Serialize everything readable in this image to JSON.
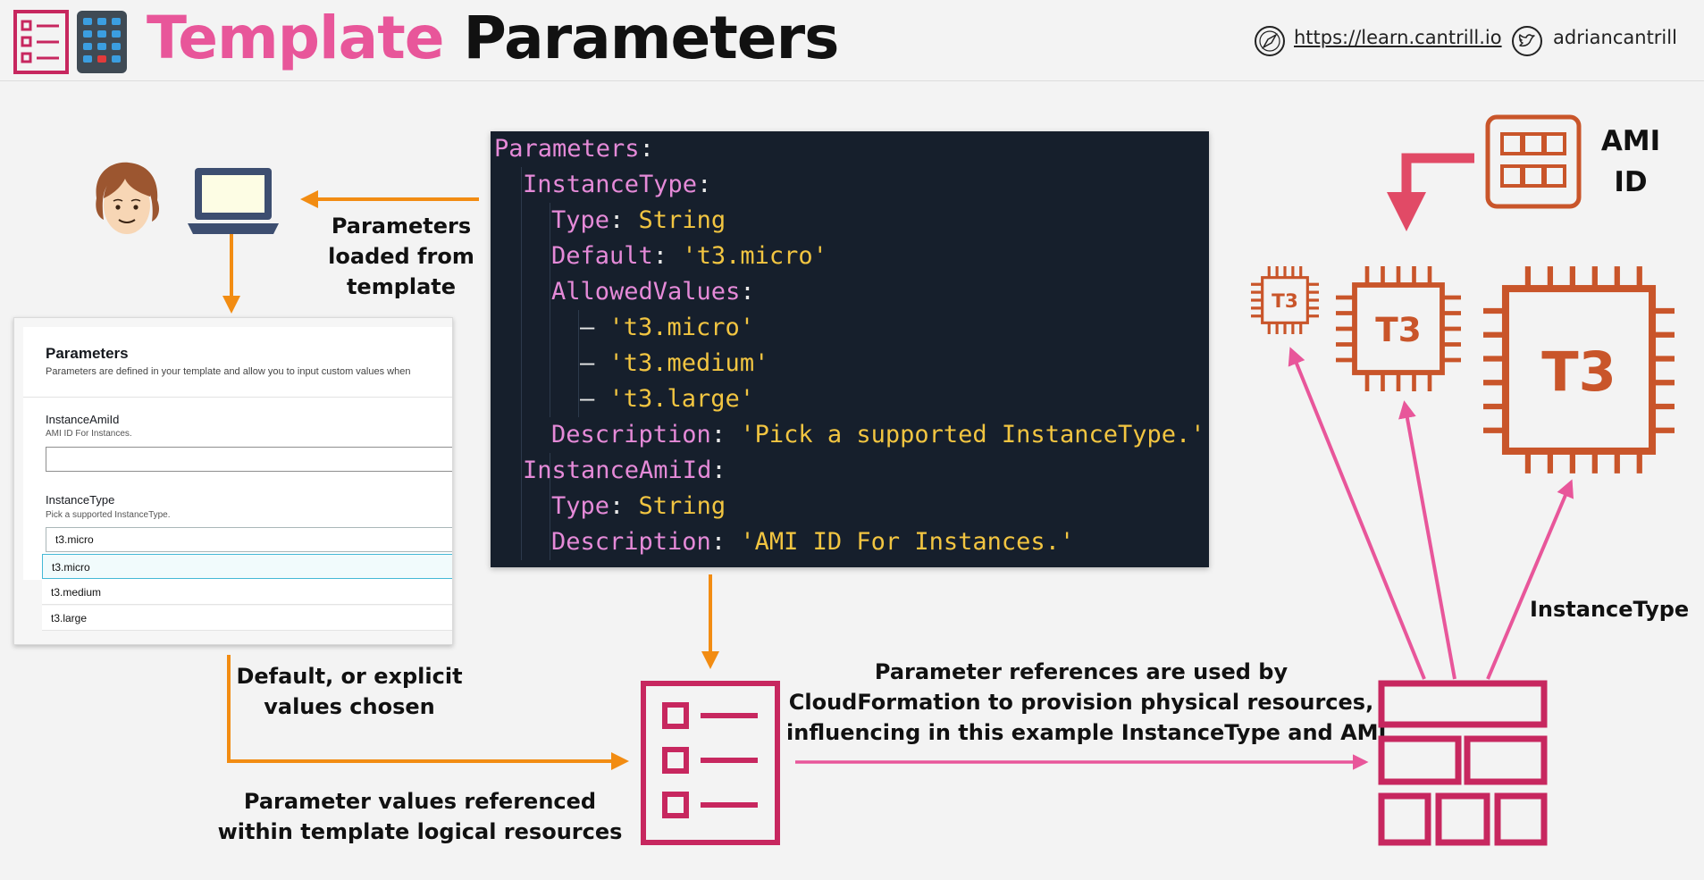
{
  "header": {
    "title_part1": "Template",
    "title_part2": "Parameters",
    "link_url": "https://learn.cantrill.io",
    "handle": "adriancantrill"
  },
  "labels": {
    "params_loaded": [
      "Parameters",
      "loaded from",
      "template"
    ],
    "default_chosen": [
      "Default, or explicit",
      "values chosen"
    ],
    "values_referenced": [
      "Parameter values referenced",
      "within template logical resources"
    ],
    "references_used": [
      "Parameter references are used by",
      "CloudFormation to provision physical resources,",
      "influencing in this example InstanceType and AMI"
    ],
    "ami_id": [
      "AMI",
      "ID"
    ],
    "instance_type": "InstanceType"
  },
  "chip_labels": {
    "small": "T3",
    "medium": "T3",
    "large": "T3"
  },
  "code": {
    "l1_key": "Parameters",
    "l2_key": "InstanceType",
    "l3_key": "Type",
    "l3_val": "String",
    "l4_key": "Default",
    "l4_val": "'t3.micro'",
    "l5_key": "AllowedValues",
    "l6_val": "'t3.micro'",
    "l7_val": "'t3.medium'",
    "l8_val": "'t3.large'",
    "l9_key": "Description",
    "l9_val": "'Pick a supported InstanceType.'",
    "l10_key": "InstanceAmiId",
    "l11_key": "Type",
    "l11_val": "String",
    "l12_key": "Description",
    "l12_val": "'AMI ID For Instances.'"
  },
  "form": {
    "title": "Parameters",
    "description": "Parameters are defined in your template and allow you to input custom values when",
    "field1_label": "InstanceAmiId",
    "field1_desc": "AMI ID For Instances.",
    "field1_value": "",
    "field2_label": "InstanceType",
    "field2_desc": "Pick a supported InstanceType.",
    "field2_value": "t3.micro",
    "options": [
      "t3.micro",
      "t3.medium",
      "t3.large"
    ]
  },
  "colors": {
    "pink": "#e8569a",
    "crimson": "#c7275f",
    "orange": "#f28c12",
    "ec2_orange": "#c9552a",
    "code_bg": "#161f2c",
    "code_key": "#e58ad8",
    "code_string": "#f2c541"
  },
  "icons": [
    "checklist-icon",
    "calculator-icon",
    "compass-icon",
    "twitter-icon",
    "user-avatar-icon",
    "laptop-icon",
    "template-icon",
    "stack-icon",
    "ami-icon",
    "chip-icon"
  ]
}
